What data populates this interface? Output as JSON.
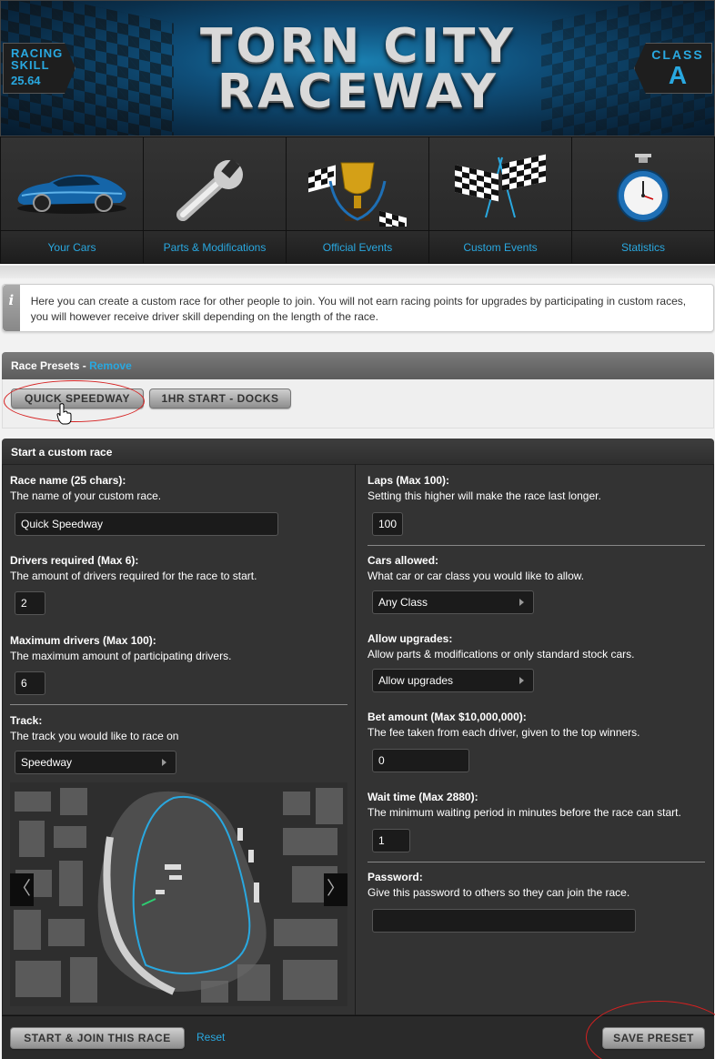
{
  "banner": {
    "title_line1": "TORN CITY",
    "title_line2": "RACEWAY",
    "skill_label_1": "RACING",
    "skill_label_2": "SKILL",
    "skill_value": "25.64",
    "class_label": "CLASS",
    "class_value": "A",
    "accent_color": "#29a8e0"
  },
  "nav": {
    "items": [
      {
        "label": "Your Cars",
        "icon": "car-icon"
      },
      {
        "label": "Parts & Modifications",
        "icon": "wrench-icon"
      },
      {
        "label": "Official Events",
        "icon": "trophy-icon"
      },
      {
        "label": "Custom Events",
        "icon": "checkered-flags-icon"
      },
      {
        "label": "Statistics",
        "icon": "stopwatch-icon"
      }
    ]
  },
  "info": {
    "icon": "i",
    "text": "Here you can create a custom race for other people to join. You will not earn racing points for upgrades by participating in custom races, you will however receive driver skill depending on the length of the race."
  },
  "presets": {
    "title": "Race Presets",
    "dash": " - ",
    "remove_label": "Remove",
    "buttons": [
      "QUICK SPEEDWAY",
      "1HR START - DOCKS"
    ]
  },
  "form": {
    "title": "Start a custom race",
    "race_name": {
      "title": "Race name (25 chars):",
      "desc": "The name of your custom race.",
      "value": "Quick Speedway"
    },
    "drivers_required": {
      "title": "Drivers required (Max 6):",
      "desc": "The amount of drivers required for the race to start.",
      "value": "2"
    },
    "max_drivers": {
      "title": "Maximum drivers (Max 100):",
      "desc": "The maximum amount of participating drivers.",
      "value": "6"
    },
    "track": {
      "title": "Track:",
      "desc": "The track you would like to race on",
      "value": "Speedway"
    },
    "laps": {
      "title": "Laps (Max 100):",
      "desc": "Setting this higher will make the race last longer.",
      "value": "100"
    },
    "cars_allowed": {
      "title": "Cars allowed:",
      "desc": "What car or car class you would like to allow.",
      "value": "Any Class"
    },
    "allow_upgrades": {
      "title": "Allow upgrades:",
      "desc": "Allow parts & modifications or only standard stock cars.",
      "value": "Allow upgrades"
    },
    "bet_amount": {
      "title": "Bet amount (Max $10,000,000):",
      "desc": "The fee taken from each driver, given to the top winners.",
      "value": "0"
    },
    "wait_time": {
      "title": "Wait time (Max 2880):",
      "desc": "The minimum waiting period in minutes before the race can start.",
      "value": "1"
    },
    "password": {
      "title": "Password:",
      "desc": "Give this password to others so they can join the race.",
      "value": ""
    },
    "map_prev": "〈",
    "map_next": "〉"
  },
  "footer": {
    "start_label": "START & JOIN THIS RACE",
    "reset_label": "Reset",
    "save_label": "SAVE PRESET"
  }
}
